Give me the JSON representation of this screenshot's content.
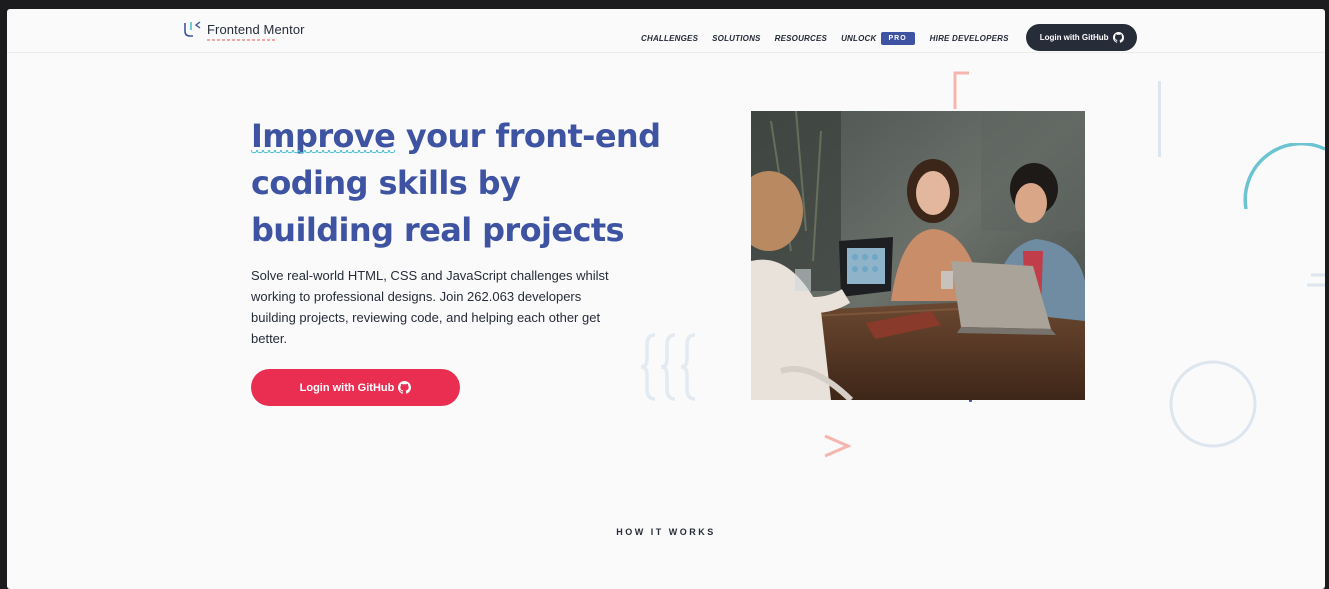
{
  "brand": {
    "name": "Frontend Mentor"
  },
  "nav": {
    "items": [
      "CHALLENGES",
      "SOLUTIONS",
      "RESOURCES"
    ],
    "unlock_label": "UNLOCK",
    "pro_badge": "PRO",
    "hire_label": "HIRE DEVELOPERS",
    "login_label": "Login with GitHub"
  },
  "hero": {
    "headline_highlight": "Improve",
    "headline_rest": " your front-end coding skills by building real projects",
    "description": "Solve real-world HTML, CSS and JavaScript challenges whilst working to professional designs. Join 262.063 developers building projects, reviewing code, and helping each other get better.",
    "cta_label": "Login with GitHub"
  },
  "section": {
    "how_it_works": "HOW IT WORKS"
  },
  "colors": {
    "primary_blue": "#3e54a3",
    "cta_red": "#e92e52",
    "dark": "#262c38",
    "teal": "#4dc0cf",
    "coral": "#f3a7a7"
  },
  "icons": [
    "frontend-mentor-logo-icon",
    "github-icon",
    "curly-braces-icon",
    "chevron-right-icon",
    "bracket-icon",
    "circle-outline-icon",
    "arc-icon"
  ]
}
